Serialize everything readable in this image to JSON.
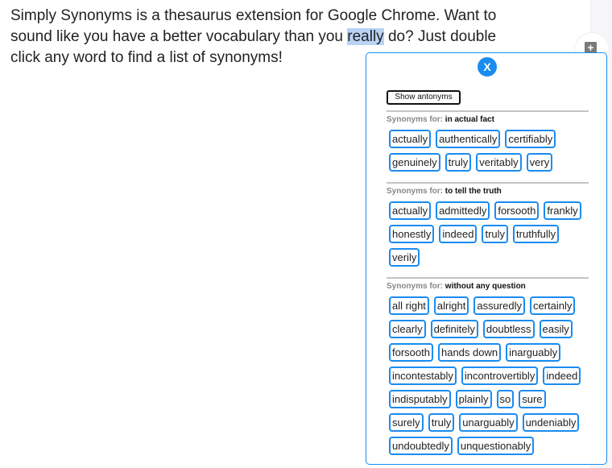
{
  "article": {
    "text_before": "Simply Synonyms is a thesaurus extension for Google Chrome. Want to sound like you have a better vocabulary than you ",
    "highlighted_word": "really",
    "text_after": " do? Just double click any word to find a list of synonyms!"
  },
  "fab": {
    "icon": "plus-icon",
    "glyph": "+"
  },
  "popup": {
    "close_label": "X",
    "show_antonyms_label": "Show antonyms",
    "synonyms_for_label": "Synonyms for:",
    "accent_color": "#1a8cf0",
    "sections": [
      {
        "term": "in actual fact",
        "words": [
          "actually",
          "authentically",
          "certifiably",
          "genuinely",
          "truly",
          "veritably",
          "very"
        ]
      },
      {
        "term": "to tell the truth",
        "words": [
          "actually",
          "admittedly",
          "forsooth",
          "frankly",
          "honestly",
          "indeed",
          "truly",
          "truthfully",
          "verily"
        ]
      },
      {
        "term": "without any question",
        "words": [
          "all right",
          "alright",
          "assuredly",
          "certainly",
          "clearly",
          "definitely",
          "doubtless",
          "easily",
          "forsooth",
          "hands down",
          "inarguably",
          "incontestably",
          "incontrovertibly",
          "indeed",
          "indisputably",
          "plainly",
          "so",
          "sure",
          "surely",
          "truly",
          "unarguably",
          "undeniably",
          "undoubtedly",
          "unquestionably"
        ]
      }
    ]
  }
}
